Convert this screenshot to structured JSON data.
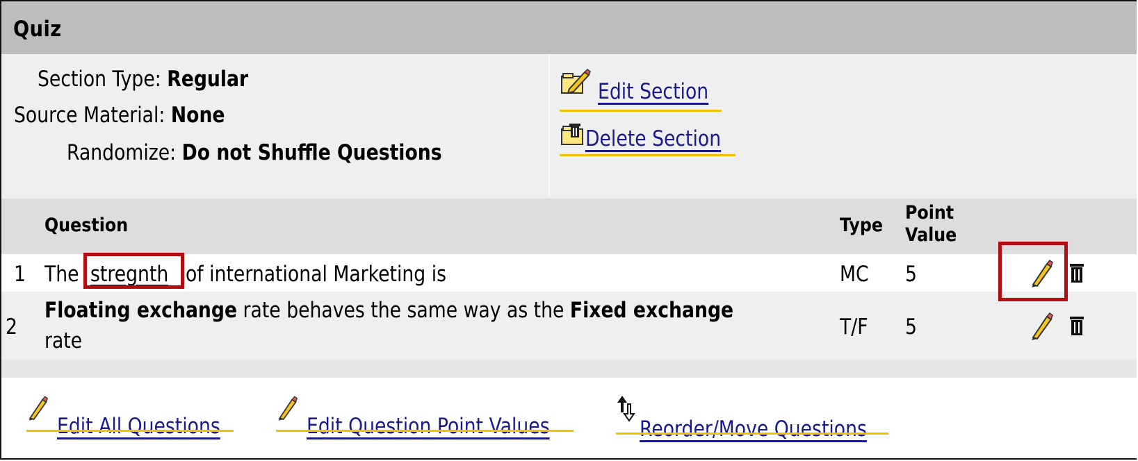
{
  "header": {
    "title": "Quiz"
  },
  "section_info": {
    "section_type": {
      "label": "Section Type:",
      "value": "Regular"
    },
    "source_material": {
      "label": "Source Material:",
      "value": "None"
    },
    "randomize": {
      "label": "Randomize:",
      "value": "Do not Shuffle Questions"
    },
    "edit_section": {
      "label": "Edit Section",
      "icon": "edit-section-icon"
    },
    "delete_section": {
      "label": "Delete Section",
      "icon": "delete-section-icon"
    }
  },
  "table": {
    "headers": {
      "question": "Question",
      "type": "Type",
      "point_value_1": "Point",
      "point_value_2": "Value"
    },
    "rows": [
      {
        "number": "1",
        "text_pre": "The",
        "text_highlight": "stregnth",
        "text_post": "of international Marketing is",
        "type": "MC",
        "points": "5"
      },
      {
        "number": "2",
        "bold1": "Floating exchange",
        "mid": "rate behaves the same way as the",
        "bold2": "Fixed exchange",
        "line2": "rate",
        "type": "T/F",
        "points": "5"
      }
    ]
  },
  "footer": {
    "edit_all": "Edit All Questions",
    "edit_points": "Edit Question Point Values",
    "reorder": "Reorder/Move Questions"
  },
  "colors": {
    "highlight_border": "#b30d12",
    "link_underline": "#f2c200",
    "header_bg": "#bdbdbd"
  }
}
